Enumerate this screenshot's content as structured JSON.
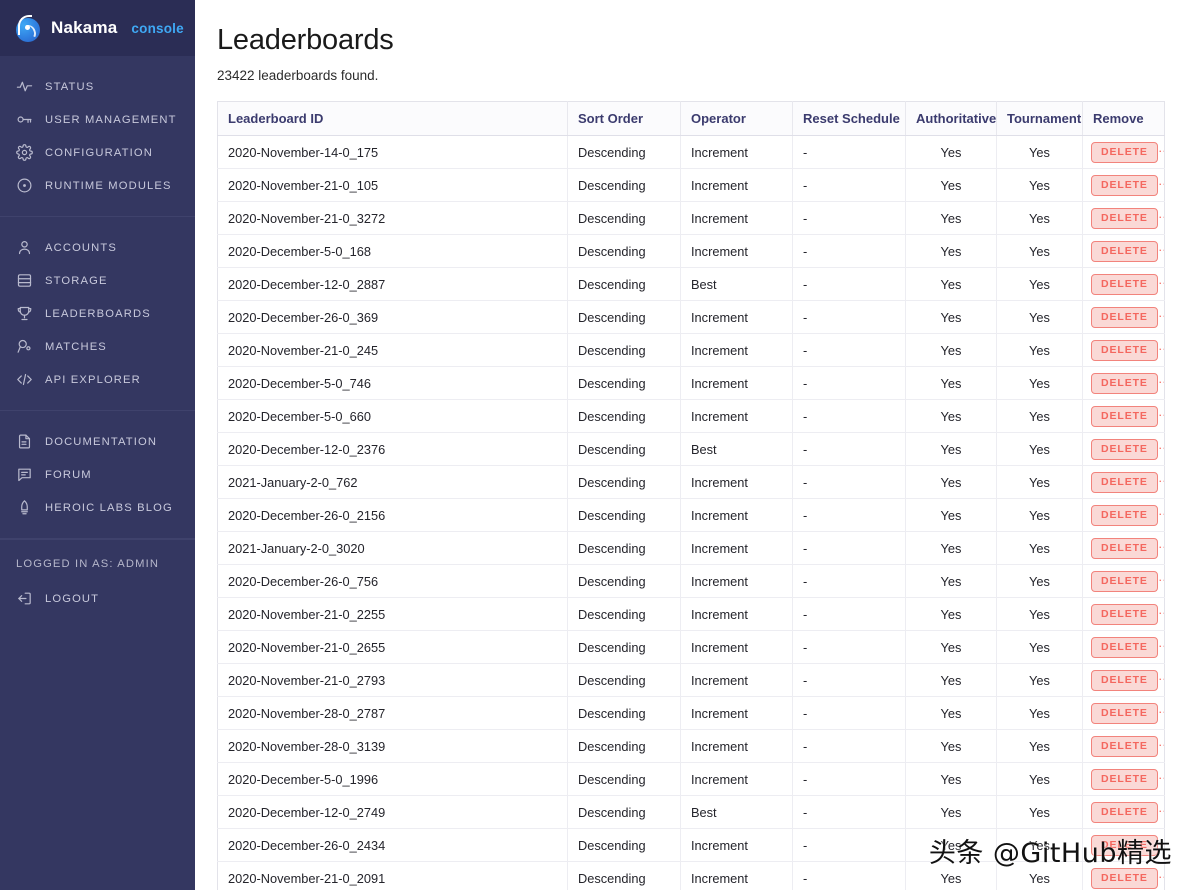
{
  "brand": {
    "name": "Nakama",
    "sub": "console",
    "logo_icon": "nakama-logo-icon"
  },
  "sidebar": {
    "groups": [
      {
        "items": [
          {
            "label": "STATUS",
            "icon": "activity-pulse-icon"
          },
          {
            "label": "USER MANAGEMENT",
            "icon": "key-icon"
          },
          {
            "label": "CONFIGURATION",
            "icon": "gear-icon"
          },
          {
            "label": "RUNTIME MODULES",
            "icon": "circle-dot-icon"
          }
        ]
      },
      {
        "items": [
          {
            "label": "ACCOUNTS",
            "icon": "user-icon"
          },
          {
            "label": "STORAGE",
            "icon": "database-icon"
          },
          {
            "label": "LEADERBOARDS",
            "icon": "trophy-icon"
          },
          {
            "label": "MATCHES",
            "icon": "match-search-icon"
          },
          {
            "label": "API EXPLORER",
            "icon": "code-brackets-icon"
          }
        ]
      },
      {
        "items": [
          {
            "label": "DOCUMENTATION",
            "icon": "document-icon"
          },
          {
            "label": "FORUM",
            "icon": "chat-bubble-icon"
          },
          {
            "label": "HEROIC LABS BLOG",
            "icon": "rocket-icon"
          }
        ]
      }
    ],
    "logged_in_as": "LOGGED IN AS: ADMIN",
    "logout": {
      "label": "LOGOUT",
      "icon": "logout-arrow-icon"
    }
  },
  "main": {
    "title": "Leaderboards",
    "subtitle": "23422 leaderboards found.",
    "table": {
      "columns": [
        "Leaderboard ID",
        "Sort Order",
        "Operator",
        "Reset Schedule",
        "Authoritative",
        "Tournament",
        "Remove"
      ],
      "delete_label": "DELETE",
      "rows": [
        {
          "id": "2020-November-14-0_175",
          "sort": "Descending",
          "op": "Increment",
          "reset": "-",
          "auth": "Yes",
          "tournament": "Yes"
        },
        {
          "id": "2020-November-21-0_105",
          "sort": "Descending",
          "op": "Increment",
          "reset": "-",
          "auth": "Yes",
          "tournament": "Yes"
        },
        {
          "id": "2020-November-21-0_3272",
          "sort": "Descending",
          "op": "Increment",
          "reset": "-",
          "auth": "Yes",
          "tournament": "Yes"
        },
        {
          "id": "2020-December-5-0_168",
          "sort": "Descending",
          "op": "Increment",
          "reset": "-",
          "auth": "Yes",
          "tournament": "Yes"
        },
        {
          "id": "2020-December-12-0_2887",
          "sort": "Descending",
          "op": "Best",
          "reset": "-",
          "auth": "Yes",
          "tournament": "Yes"
        },
        {
          "id": "2020-December-26-0_369",
          "sort": "Descending",
          "op": "Increment",
          "reset": "-",
          "auth": "Yes",
          "tournament": "Yes"
        },
        {
          "id": "2020-November-21-0_245",
          "sort": "Descending",
          "op": "Increment",
          "reset": "-",
          "auth": "Yes",
          "tournament": "Yes"
        },
        {
          "id": "2020-December-5-0_746",
          "sort": "Descending",
          "op": "Increment",
          "reset": "-",
          "auth": "Yes",
          "tournament": "Yes"
        },
        {
          "id": "2020-December-5-0_660",
          "sort": "Descending",
          "op": "Increment",
          "reset": "-",
          "auth": "Yes",
          "tournament": "Yes"
        },
        {
          "id": "2020-December-12-0_2376",
          "sort": "Descending",
          "op": "Best",
          "reset": "-",
          "auth": "Yes",
          "tournament": "Yes"
        },
        {
          "id": "2021-January-2-0_762",
          "sort": "Descending",
          "op": "Increment",
          "reset": "-",
          "auth": "Yes",
          "tournament": "Yes"
        },
        {
          "id": "2020-December-26-0_2156",
          "sort": "Descending",
          "op": "Increment",
          "reset": "-",
          "auth": "Yes",
          "tournament": "Yes"
        },
        {
          "id": "2021-January-2-0_3020",
          "sort": "Descending",
          "op": "Increment",
          "reset": "-",
          "auth": "Yes",
          "tournament": "Yes"
        },
        {
          "id": "2020-December-26-0_756",
          "sort": "Descending",
          "op": "Increment",
          "reset": "-",
          "auth": "Yes",
          "tournament": "Yes"
        },
        {
          "id": "2020-November-21-0_2255",
          "sort": "Descending",
          "op": "Increment",
          "reset": "-",
          "auth": "Yes",
          "tournament": "Yes"
        },
        {
          "id": "2020-November-21-0_2655",
          "sort": "Descending",
          "op": "Increment",
          "reset": "-",
          "auth": "Yes",
          "tournament": "Yes"
        },
        {
          "id": "2020-November-21-0_2793",
          "sort": "Descending",
          "op": "Increment",
          "reset": "-",
          "auth": "Yes",
          "tournament": "Yes"
        },
        {
          "id": "2020-November-28-0_2787",
          "sort": "Descending",
          "op": "Increment",
          "reset": "-",
          "auth": "Yes",
          "tournament": "Yes"
        },
        {
          "id": "2020-November-28-0_3139",
          "sort": "Descending",
          "op": "Increment",
          "reset": "-",
          "auth": "Yes",
          "tournament": "Yes"
        },
        {
          "id": "2020-December-5-0_1996",
          "sort": "Descending",
          "op": "Increment",
          "reset": "-",
          "auth": "Yes",
          "tournament": "Yes"
        },
        {
          "id": "2020-December-12-0_2749",
          "sort": "Descending",
          "op": "Best",
          "reset": "-",
          "auth": "Yes",
          "tournament": "Yes"
        },
        {
          "id": "2020-December-26-0_2434",
          "sort": "Descending",
          "op": "Increment",
          "reset": "-",
          "auth": "Yes",
          "tournament": "Yes"
        },
        {
          "id": "2020-November-21-0_2091",
          "sort": "Descending",
          "op": "Increment",
          "reset": "-",
          "auth": "Yes",
          "tournament": "Yes"
        }
      ]
    }
  },
  "watermark": {
    "text": "头条 @GitHub精选"
  },
  "colors": {
    "sidebar_bg": "#343761",
    "sidebar_header_bg": "#2b2d55",
    "brand_accent": "#3fa9f5",
    "table_header_text": "#3b3b6e",
    "delete_text": "#f4675f",
    "delete_bg": "#fad9d6",
    "delete_border": "#f2837c"
  }
}
